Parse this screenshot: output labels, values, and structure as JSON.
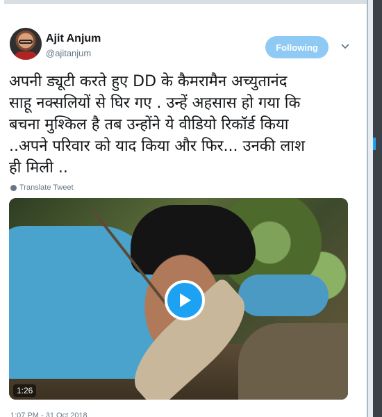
{
  "author": {
    "name": "Ajit Anjum",
    "handle": "@ajitanjum",
    "avatar_icon": "profile-avatar"
  },
  "header": {
    "follow_label": "Following",
    "menu_icon": "chevron-down-icon"
  },
  "tweet": {
    "text": "अपनी ड्यूटी करते हुए DD के कैमरामैन अच्युतानंद\nसाहू नक्सलियों से घिर गए . उन्हें अहसास हो गया कि\nबचना मुश्किल है तब उन्होंने ये वीडियो रिकॉर्ड किया\n..अपने परिवार को याद किया और फिर... उनकी लाश\nही मिली ..",
    "translate_label": "Translate Tweet",
    "timestamp": "1:07 PM - 31 Oct 2018"
  },
  "media": {
    "duration": "1:26",
    "play_icon": "play-icon"
  },
  "colors": {
    "accent": "#1da1f2",
    "follow_bg": "#8fcaf4",
    "secondary_text": "#657786",
    "primary_text": "#14171a"
  }
}
